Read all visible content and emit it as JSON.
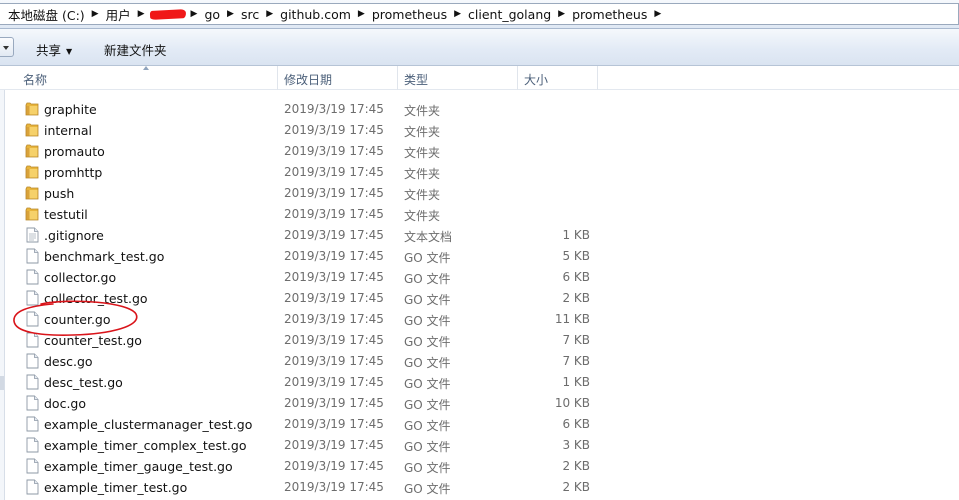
{
  "address": {
    "crumbs": [
      "本地磁盘 (C:)",
      "用户",
      "go",
      "src",
      "github.com",
      "prometheus",
      "client_golang",
      "prometheus"
    ]
  },
  "toolbar": {
    "share_label": "共享",
    "new_folder_label": "新建文件夹"
  },
  "columns": {
    "name": "名称",
    "modified": "修改日期",
    "type": "类型",
    "size": "大小"
  },
  "files": [
    {
      "name": "graphite",
      "date": "2019/3/19 17:45",
      "type": "文件夹",
      "size": "",
      "kind": "folder"
    },
    {
      "name": "internal",
      "date": "2019/3/19 17:45",
      "type": "文件夹",
      "size": "",
      "kind": "folder"
    },
    {
      "name": "promauto",
      "date": "2019/3/19 17:45",
      "type": "文件夹",
      "size": "",
      "kind": "folder"
    },
    {
      "name": "promhttp",
      "date": "2019/3/19 17:45",
      "type": "文件夹",
      "size": "",
      "kind": "folder"
    },
    {
      "name": "push",
      "date": "2019/3/19 17:45",
      "type": "文件夹",
      "size": "",
      "kind": "folder"
    },
    {
      "name": "testutil",
      "date": "2019/3/19 17:45",
      "type": "文件夹",
      "size": "",
      "kind": "folder"
    },
    {
      "name": ".gitignore",
      "date": "2019/3/19 17:45",
      "type": "文本文档",
      "size": "1 KB",
      "kind": "text"
    },
    {
      "name": "benchmark_test.go",
      "date": "2019/3/19 17:45",
      "type": "GO 文件",
      "size": "5 KB",
      "kind": "file"
    },
    {
      "name": "collector.go",
      "date": "2019/3/19 17:45",
      "type": "GO 文件",
      "size": "6 KB",
      "kind": "file"
    },
    {
      "name": "collector_test.go",
      "date": "2019/3/19 17:45",
      "type": "GO 文件",
      "size": "2 KB",
      "kind": "file"
    },
    {
      "name": "counter.go",
      "date": "2019/3/19 17:45",
      "type": "GO 文件",
      "size": "11 KB",
      "kind": "file"
    },
    {
      "name": "counter_test.go",
      "date": "2019/3/19 17:45",
      "type": "GO 文件",
      "size": "7 KB",
      "kind": "file"
    },
    {
      "name": "desc.go",
      "date": "2019/3/19 17:45",
      "type": "GO 文件",
      "size": "7 KB",
      "kind": "file"
    },
    {
      "name": "desc_test.go",
      "date": "2019/3/19 17:45",
      "type": "GO 文件",
      "size": "1 KB",
      "kind": "file"
    },
    {
      "name": "doc.go",
      "date": "2019/3/19 17:45",
      "type": "GO 文件",
      "size": "10 KB",
      "kind": "file"
    },
    {
      "name": "example_clustermanager_test.go",
      "date": "2019/3/19 17:45",
      "type": "GO 文件",
      "size": "6 KB",
      "kind": "file"
    },
    {
      "name": "example_timer_complex_test.go",
      "date": "2019/3/19 17:45",
      "type": "GO 文件",
      "size": "3 KB",
      "kind": "file"
    },
    {
      "name": "example_timer_gauge_test.go",
      "date": "2019/3/19 17:45",
      "type": "GO 文件",
      "size": "2 KB",
      "kind": "file"
    },
    {
      "name": "example_timer_test.go",
      "date": "2019/3/19 17:45",
      "type": "GO 文件",
      "size": "2 KB",
      "kind": "file"
    }
  ],
  "colors": {
    "folder": "#e8b53c",
    "annotation": "#d9141a",
    "header_text": "#4c607a"
  }
}
